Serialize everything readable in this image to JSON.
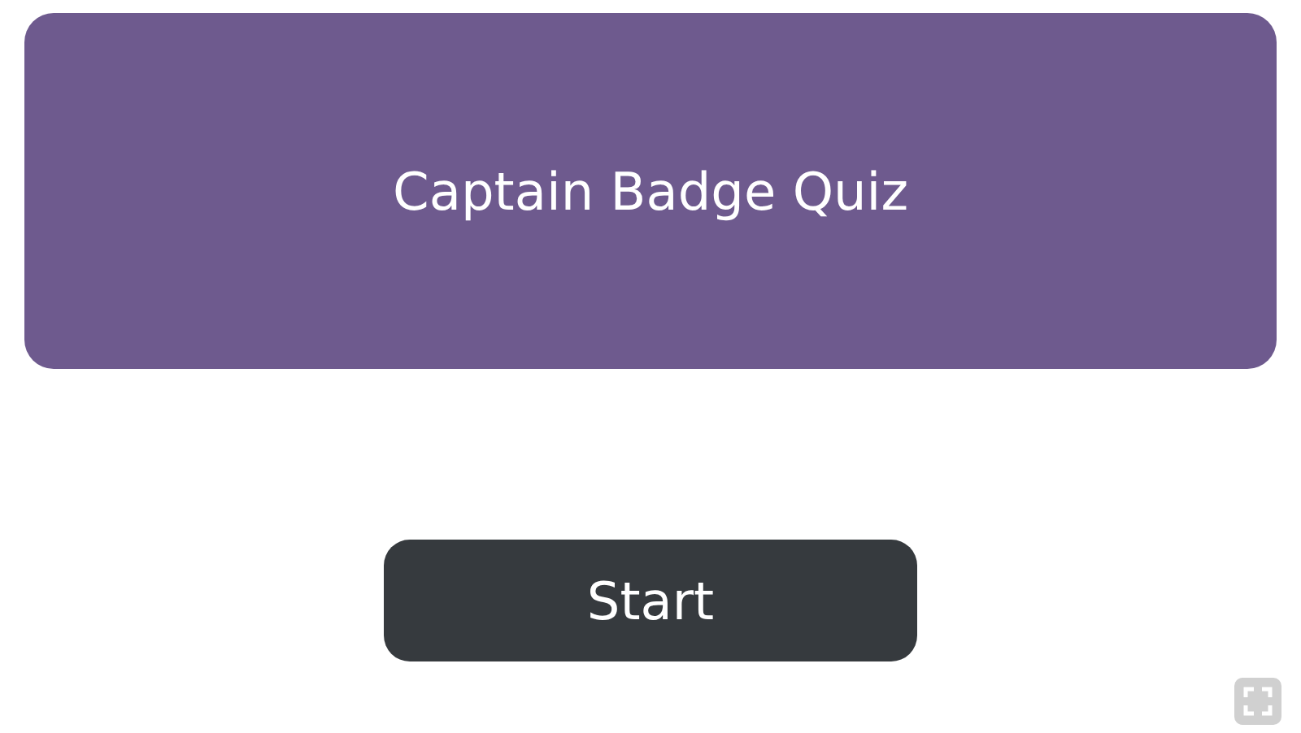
{
  "title_card": {
    "title": "Captain Badge Quiz"
  },
  "start_button": {
    "label": "Start"
  }
}
